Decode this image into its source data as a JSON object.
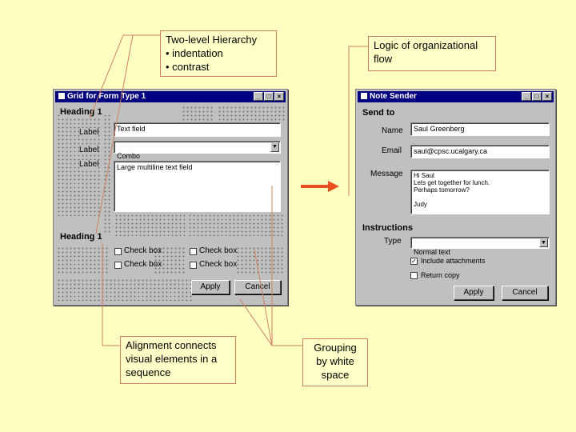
{
  "callouts": {
    "hierarchy": {
      "title": "Two-level Hierarchy",
      "line1": "• indentation",
      "line2": "• contrast"
    },
    "logic": {
      "text": "Logic of organizational flow"
    },
    "alignment": {
      "text": "Alignment connects visual elements in a sequence"
    },
    "grouping": {
      "text": "Grouping by white space"
    }
  },
  "grid_window": {
    "title": "Grid for Form Type 1",
    "heading1": "Heading 1",
    "heading2": "Heading 1",
    "labels": [
      "Label",
      "Label",
      "Label"
    ],
    "textfield": "Text field",
    "combo": "Combo",
    "multiline": "Large multiline text field",
    "checkboxes": [
      "Check box",
      "Check box",
      "Check box",
      "Check box"
    ],
    "apply": "Apply",
    "cancel": "Cancel"
  },
  "note_window": {
    "title": "Note Sender",
    "send_to": "Send to",
    "name_label": "Name",
    "name_value": "Saul Greenberg",
    "email_label": "Email",
    "email_value": "saul@cpsc.ucalgary.ca",
    "message_label": "Message",
    "message_value": "Hi Saul\nLets get together for lunch.\nPerhaps tomorrow?\n\nJudy",
    "instructions": "Instructions",
    "type_label": "Type",
    "type_value": "Normal text",
    "include_attachments": "Include attachments",
    "return_copy": "Return copy",
    "apply": "Apply",
    "cancel": "Cancel"
  },
  "colors": {
    "background": "#FFFFC0",
    "titlebar": "#000080",
    "window": "#C0C0C0",
    "arrow": "#E85020",
    "leader": "#D08060"
  }
}
